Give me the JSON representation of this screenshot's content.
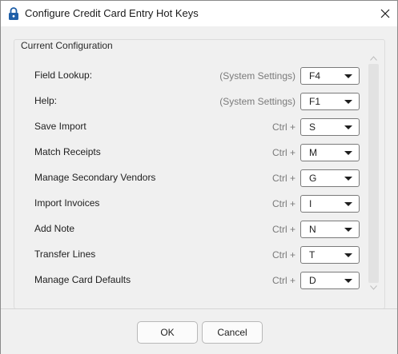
{
  "window": {
    "title": "Configure Credit Card Entry Hot Keys",
    "app_icon": "lock-icon",
    "close_icon": "close-icon"
  },
  "group": {
    "legend": "Current Configuration"
  },
  "hotkeys": [
    {
      "label": "Field Lookup:",
      "modifier": "(System Settings)",
      "key": "F4"
    },
    {
      "label": "Help:",
      "modifier": "(System Settings)",
      "key": "F1"
    },
    {
      "label": "Save Import",
      "modifier": "Ctrl +",
      "key": "S"
    },
    {
      "label": "Match Receipts",
      "modifier": "Ctrl +",
      "key": "M"
    },
    {
      "label": "Manage Secondary Vendors",
      "modifier": "Ctrl +",
      "key": "G"
    },
    {
      "label": "Import Invoices",
      "modifier": "Ctrl +",
      "key": "I"
    },
    {
      "label": "Add Note",
      "modifier": "Ctrl +",
      "key": "N"
    },
    {
      "label": "Transfer Lines",
      "modifier": "Ctrl +",
      "key": "T"
    },
    {
      "label": "Manage Card Defaults",
      "modifier": "Ctrl +",
      "key": "D"
    }
  ],
  "footer": {
    "ok_label": "OK",
    "cancel_label": "Cancel"
  },
  "colors": {
    "app_icon": "#1f5fa8",
    "window_bg": "#f0f0f0"
  }
}
